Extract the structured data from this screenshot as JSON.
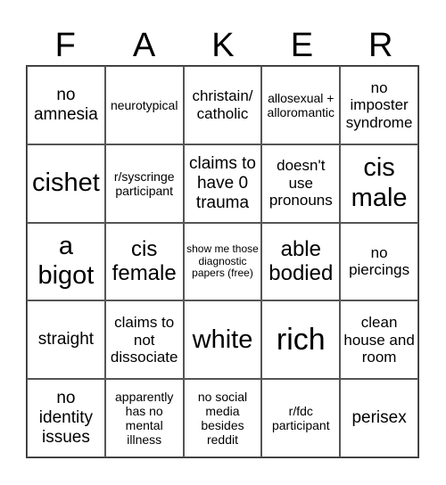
{
  "header": {
    "letters": [
      "F",
      "A",
      "K",
      "E",
      "R"
    ]
  },
  "board": {
    "cells": [
      {
        "text": "no amnesia",
        "size": "s-lg"
      },
      {
        "text": "neurotypical",
        "size": "s-sm"
      },
      {
        "text": "christain/ catholic",
        "size": "s-md"
      },
      {
        "text": "allosexual + alloromantic",
        "size": "s-sm"
      },
      {
        "text": "no imposter syndrome",
        "size": "s-md"
      },
      {
        "text": "cishet",
        "size": "s-xxl"
      },
      {
        "text": "r/syscringe participant",
        "size": "s-sm"
      },
      {
        "text": "claims to have 0 trauma",
        "size": "s-lg"
      },
      {
        "text": "doesn't use pronouns",
        "size": "s-md"
      },
      {
        "text": "cis male",
        "size": "s-xxl"
      },
      {
        "text": "a bigot",
        "size": "s-xxl"
      },
      {
        "text": "cis female",
        "size": "s-xl"
      },
      {
        "text": "show me those diagnostic papers (free)",
        "size": "s-xs"
      },
      {
        "text": "able bodied",
        "size": "s-xl"
      },
      {
        "text": "no piercings",
        "size": "s-md"
      },
      {
        "text": "straight",
        "size": "s-lg"
      },
      {
        "text": "claims to not dissociate",
        "size": "s-md"
      },
      {
        "text": "white",
        "size": "s-xxl"
      },
      {
        "text": "rich",
        "size": "s-huge"
      },
      {
        "text": "clean house and room",
        "size": "s-md"
      },
      {
        "text": "no identity issues",
        "size": "s-lg"
      },
      {
        "text": "apparently has no mental illness",
        "size": "s-sm"
      },
      {
        "text": "no social media besides reddit",
        "size": "s-sm"
      },
      {
        "text": "r/fdc participant",
        "size": "s-sm"
      },
      {
        "text": "perisex",
        "size": "s-lg"
      }
    ]
  }
}
